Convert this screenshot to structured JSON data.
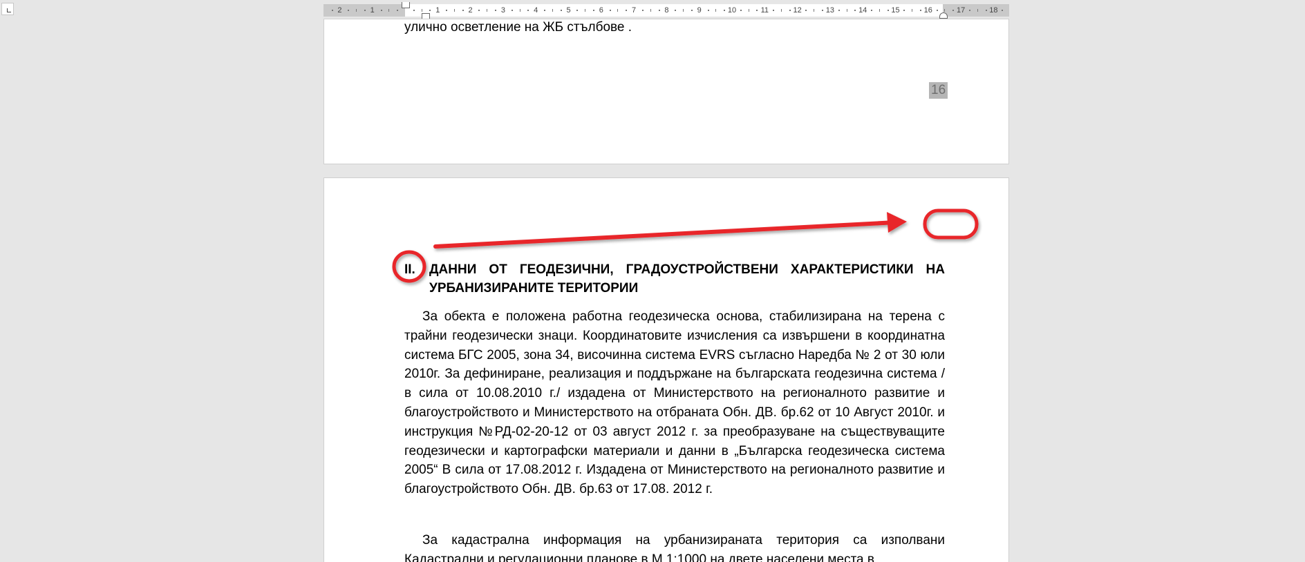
{
  "ruler": {
    "numbers": [
      "2",
      "1",
      "1",
      "1",
      "2",
      "3",
      "4",
      "5",
      "6",
      "7",
      "8",
      "9",
      "10",
      "11",
      "12",
      "13",
      "14",
      "15",
      "16",
      "17",
      "18"
    ]
  },
  "page1": {
    "last_line": "улично осветление на ЖБ стълбове .",
    "page_number": "16"
  },
  "page2": {
    "heading_num": "II.",
    "heading_text": "ДАННИ ОТ ГЕОДЕЗИЧНИ, ГРАДОУСТРОЙСТВЕНИ ХАРАКТЕРИСТИКИ НА УРБАНИЗИРАНИТЕ ТЕРИТОРИИ",
    "paragraph1": "За обекта  е положена работна геодезическа основа, стабилизирана на терена с трайни геодезически знаци. Координатовите изчисления са извършени в координатна система БГС 2005, зона 34, височинна система EVRS съгласно Наредба № 2 от 30 юли 2010г. За дефиниране, реализация и поддържане на българската геодезична система /в сила от 10.08.2010 г./ издадена от Министерството на регионалното развитие и благоустройството и Министерството на отбраната Обн. ДВ. бр.62 от 10 Август 2010г. и инструкция №РД-02-20-12 от 03 август 2012 г. за преобразуване на съществуващите геодезически и картографски материали и данни в „Българска геодезическа система 2005“ В сила от 17.08.2012 г. Издадена от Министерството на регионалното развитие и благоустройството Обн. ДВ. бр.63 от 17.08. 2012 г.",
    "paragraph2": "За кадастрална информация на урбанизираната територия са изполвани Кадастрални и регулационни планове в М 1:1000 на двете населени места в"
  },
  "annotation": {
    "color": "#e8262a"
  }
}
